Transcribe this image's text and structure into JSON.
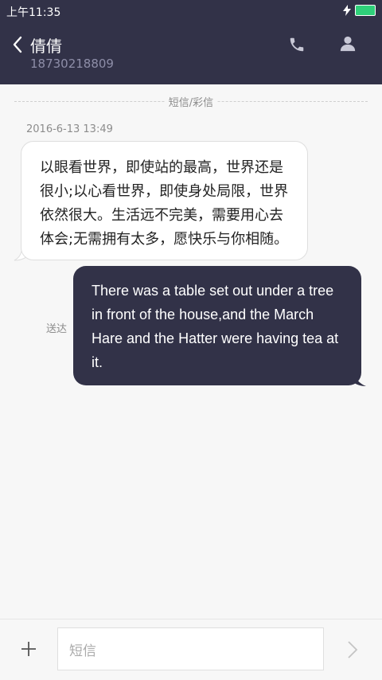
{
  "status_bar": {
    "time": "上午11:35"
  },
  "header": {
    "contact_name": "倩倩",
    "contact_number": "18730218809"
  },
  "thread": {
    "type_label": "短信/彩信",
    "timestamp": "2016-6-13 13:49",
    "received_message": "以眼看世界，即使站的最高，世界还是很小;以心看世界，即使身处局限，世界依然很大。生活远不完美，需要用心去体会;无需拥有太多，愿快乐与你相随。",
    "delivered_label": "送达",
    "sent_message": "There was a table set out under a tree in front of the house,and the March Hare and the Hatter were having tea at it."
  },
  "composer": {
    "placeholder": "短信"
  },
  "colors": {
    "header_bg": "#323248",
    "sent_bubble": "#323248",
    "battery": "#2fd07a"
  },
  "icons": [
    "back-icon",
    "call-icon",
    "profile-icon",
    "plus-icon",
    "send-icon",
    "charging-icon",
    "battery-icon"
  ]
}
